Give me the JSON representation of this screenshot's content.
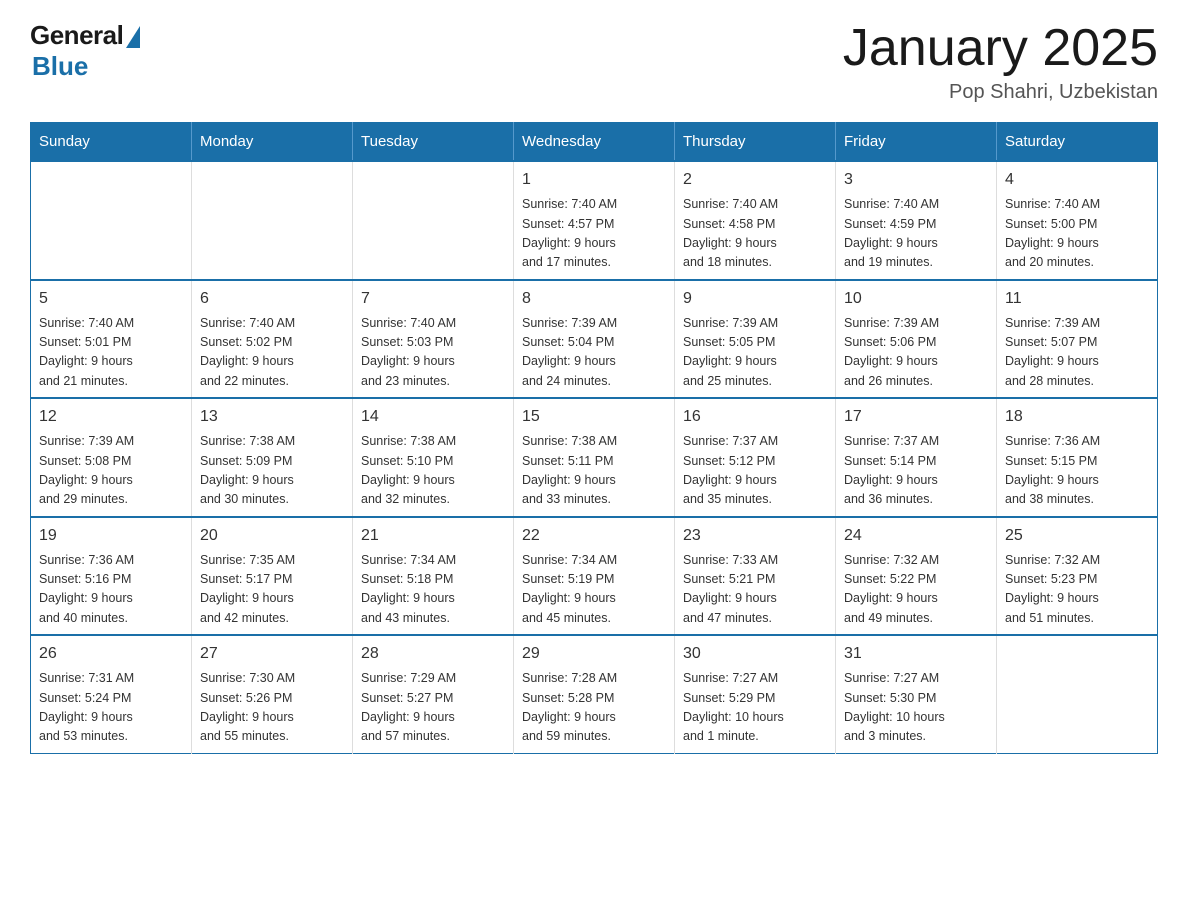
{
  "header": {
    "logo_general": "General",
    "logo_blue": "Blue",
    "title": "January 2025",
    "location": "Pop Shahri, Uzbekistan"
  },
  "days_of_week": [
    "Sunday",
    "Monday",
    "Tuesday",
    "Wednesday",
    "Thursday",
    "Friday",
    "Saturday"
  ],
  "weeks": [
    [
      {
        "day": "",
        "info": ""
      },
      {
        "day": "",
        "info": ""
      },
      {
        "day": "",
        "info": ""
      },
      {
        "day": "1",
        "info": "Sunrise: 7:40 AM\nSunset: 4:57 PM\nDaylight: 9 hours\nand 17 minutes."
      },
      {
        "day": "2",
        "info": "Sunrise: 7:40 AM\nSunset: 4:58 PM\nDaylight: 9 hours\nand 18 minutes."
      },
      {
        "day": "3",
        "info": "Sunrise: 7:40 AM\nSunset: 4:59 PM\nDaylight: 9 hours\nand 19 minutes."
      },
      {
        "day": "4",
        "info": "Sunrise: 7:40 AM\nSunset: 5:00 PM\nDaylight: 9 hours\nand 20 minutes."
      }
    ],
    [
      {
        "day": "5",
        "info": "Sunrise: 7:40 AM\nSunset: 5:01 PM\nDaylight: 9 hours\nand 21 minutes."
      },
      {
        "day": "6",
        "info": "Sunrise: 7:40 AM\nSunset: 5:02 PM\nDaylight: 9 hours\nand 22 minutes."
      },
      {
        "day": "7",
        "info": "Sunrise: 7:40 AM\nSunset: 5:03 PM\nDaylight: 9 hours\nand 23 minutes."
      },
      {
        "day": "8",
        "info": "Sunrise: 7:39 AM\nSunset: 5:04 PM\nDaylight: 9 hours\nand 24 minutes."
      },
      {
        "day": "9",
        "info": "Sunrise: 7:39 AM\nSunset: 5:05 PM\nDaylight: 9 hours\nand 25 minutes."
      },
      {
        "day": "10",
        "info": "Sunrise: 7:39 AM\nSunset: 5:06 PM\nDaylight: 9 hours\nand 26 minutes."
      },
      {
        "day": "11",
        "info": "Sunrise: 7:39 AM\nSunset: 5:07 PM\nDaylight: 9 hours\nand 28 minutes."
      }
    ],
    [
      {
        "day": "12",
        "info": "Sunrise: 7:39 AM\nSunset: 5:08 PM\nDaylight: 9 hours\nand 29 minutes."
      },
      {
        "day": "13",
        "info": "Sunrise: 7:38 AM\nSunset: 5:09 PM\nDaylight: 9 hours\nand 30 minutes."
      },
      {
        "day": "14",
        "info": "Sunrise: 7:38 AM\nSunset: 5:10 PM\nDaylight: 9 hours\nand 32 minutes."
      },
      {
        "day": "15",
        "info": "Sunrise: 7:38 AM\nSunset: 5:11 PM\nDaylight: 9 hours\nand 33 minutes."
      },
      {
        "day": "16",
        "info": "Sunrise: 7:37 AM\nSunset: 5:12 PM\nDaylight: 9 hours\nand 35 minutes."
      },
      {
        "day": "17",
        "info": "Sunrise: 7:37 AM\nSunset: 5:14 PM\nDaylight: 9 hours\nand 36 minutes."
      },
      {
        "day": "18",
        "info": "Sunrise: 7:36 AM\nSunset: 5:15 PM\nDaylight: 9 hours\nand 38 minutes."
      }
    ],
    [
      {
        "day": "19",
        "info": "Sunrise: 7:36 AM\nSunset: 5:16 PM\nDaylight: 9 hours\nand 40 minutes."
      },
      {
        "day": "20",
        "info": "Sunrise: 7:35 AM\nSunset: 5:17 PM\nDaylight: 9 hours\nand 42 minutes."
      },
      {
        "day": "21",
        "info": "Sunrise: 7:34 AM\nSunset: 5:18 PM\nDaylight: 9 hours\nand 43 minutes."
      },
      {
        "day": "22",
        "info": "Sunrise: 7:34 AM\nSunset: 5:19 PM\nDaylight: 9 hours\nand 45 minutes."
      },
      {
        "day": "23",
        "info": "Sunrise: 7:33 AM\nSunset: 5:21 PM\nDaylight: 9 hours\nand 47 minutes."
      },
      {
        "day": "24",
        "info": "Sunrise: 7:32 AM\nSunset: 5:22 PM\nDaylight: 9 hours\nand 49 minutes."
      },
      {
        "day": "25",
        "info": "Sunrise: 7:32 AM\nSunset: 5:23 PM\nDaylight: 9 hours\nand 51 minutes."
      }
    ],
    [
      {
        "day": "26",
        "info": "Sunrise: 7:31 AM\nSunset: 5:24 PM\nDaylight: 9 hours\nand 53 minutes."
      },
      {
        "day": "27",
        "info": "Sunrise: 7:30 AM\nSunset: 5:26 PM\nDaylight: 9 hours\nand 55 minutes."
      },
      {
        "day": "28",
        "info": "Sunrise: 7:29 AM\nSunset: 5:27 PM\nDaylight: 9 hours\nand 57 minutes."
      },
      {
        "day": "29",
        "info": "Sunrise: 7:28 AM\nSunset: 5:28 PM\nDaylight: 9 hours\nand 59 minutes."
      },
      {
        "day": "30",
        "info": "Sunrise: 7:27 AM\nSunset: 5:29 PM\nDaylight: 10 hours\nand 1 minute."
      },
      {
        "day": "31",
        "info": "Sunrise: 7:27 AM\nSunset: 5:30 PM\nDaylight: 10 hours\nand 3 minutes."
      },
      {
        "day": "",
        "info": ""
      }
    ]
  ]
}
